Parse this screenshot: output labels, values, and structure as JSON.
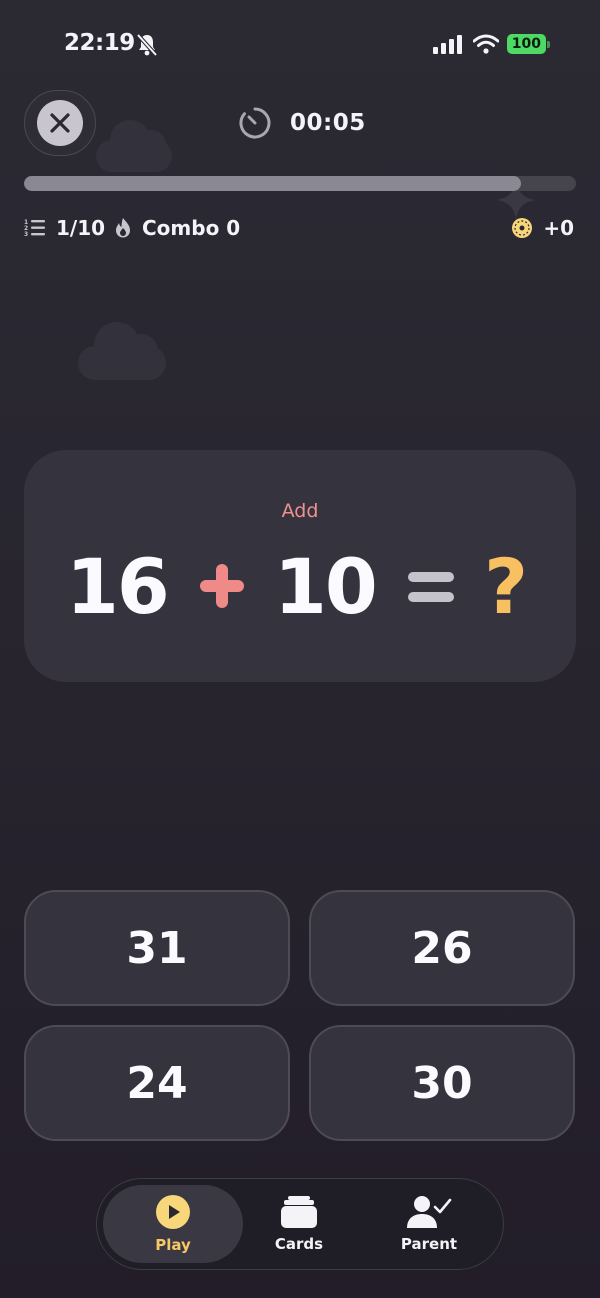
{
  "status_bar": {
    "time": "22:19",
    "battery": "100"
  },
  "header": {
    "timer": "00:05",
    "progress": 0.9
  },
  "stats": {
    "question_progress": "1/10",
    "combo": "Combo 0",
    "coins": "+0"
  },
  "question": {
    "operation_label": "Add",
    "operand_a": "16",
    "operand_b": "10",
    "unknown": "?"
  },
  "answers": [
    "31",
    "26",
    "24",
    "30"
  ],
  "nav": {
    "items": [
      {
        "label": "Play",
        "icon": "play-icon",
        "active": true
      },
      {
        "label": "Cards",
        "icon": "cards-icon",
        "active": false
      },
      {
        "label": "Parent",
        "icon": "parent-icon",
        "active": false
      }
    ]
  },
  "colors": {
    "accent_plus": "#f08a88",
    "accent_question": "#f8c060",
    "battery": "#4cd964"
  }
}
